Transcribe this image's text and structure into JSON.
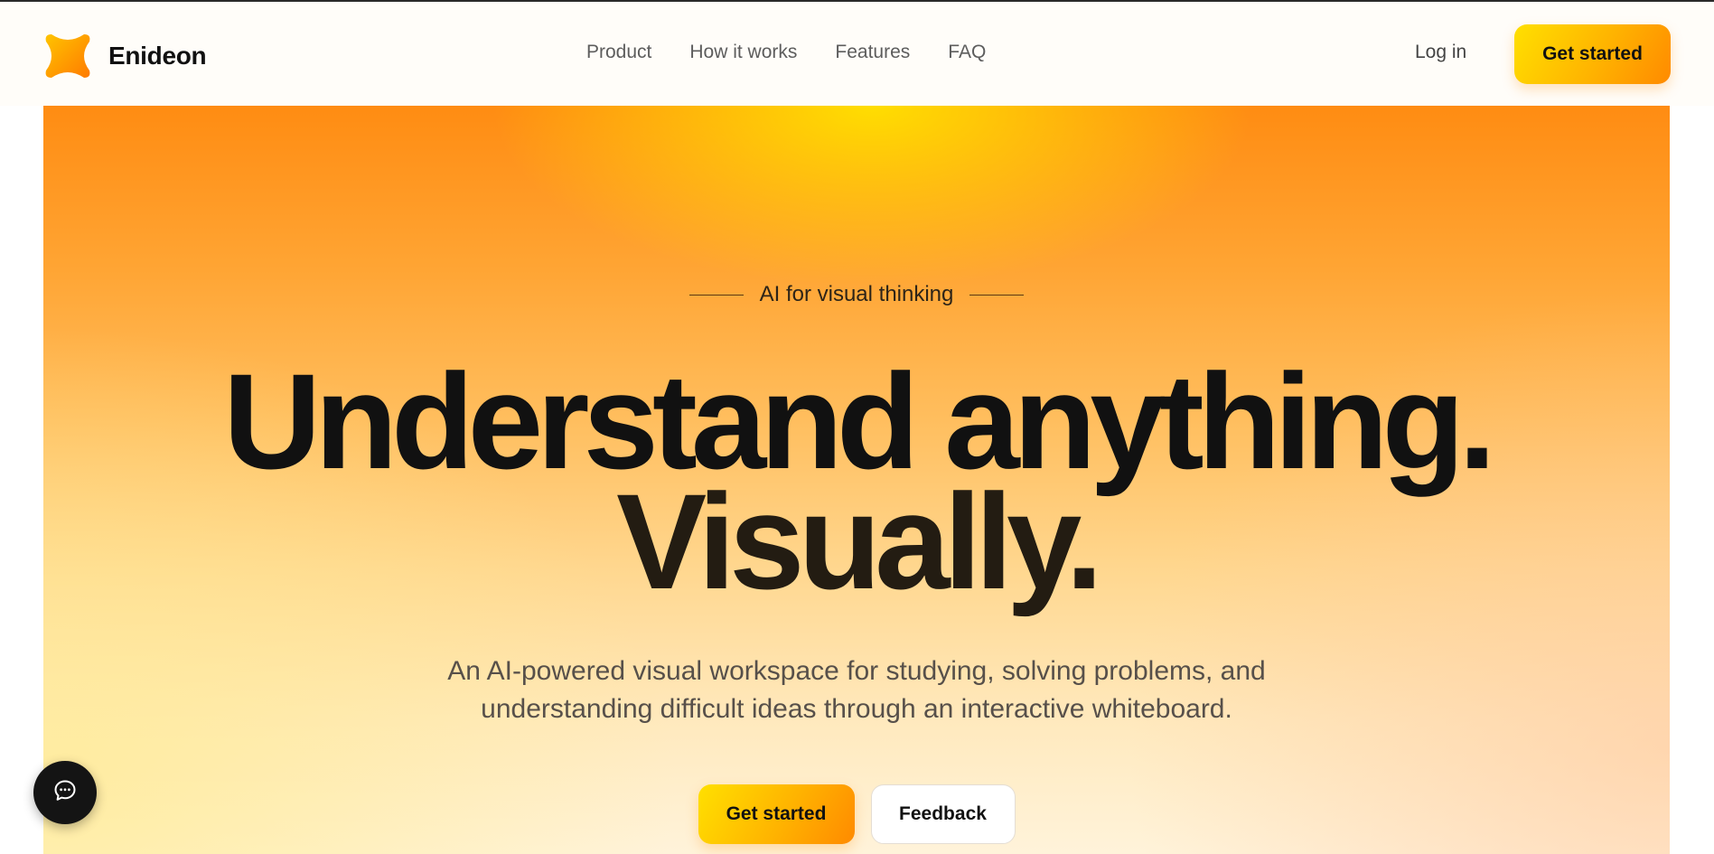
{
  "header": {
    "brand": "Enideon",
    "nav": [
      {
        "label": "Product"
      },
      {
        "label": "How it works"
      },
      {
        "label": "Features"
      },
      {
        "label": "FAQ"
      }
    ],
    "login_label": "Log in",
    "cta_label": "Get started"
  },
  "hero": {
    "eyebrow": "AI for visual thinking",
    "headline_line1": "Understand anything.",
    "headline_line2": "Visually.",
    "subtext_line1": "An AI-powered visual workspace for studying, solving problems, and",
    "subtext_line2": "understanding difficult ideas through an interactive whiteboard.",
    "primary_cta": "Get started",
    "secondary_cta": "Feedback"
  },
  "icons": {
    "logo": "logo-icon",
    "chat": "chat-icon"
  },
  "colors": {
    "accent_start": "#ffe000",
    "accent_end": "#ff8a00",
    "hero_top": "#ff8c12",
    "hero_bottom": "#fff3da",
    "text_dark": "#111111",
    "chat_bg": "#141414"
  }
}
